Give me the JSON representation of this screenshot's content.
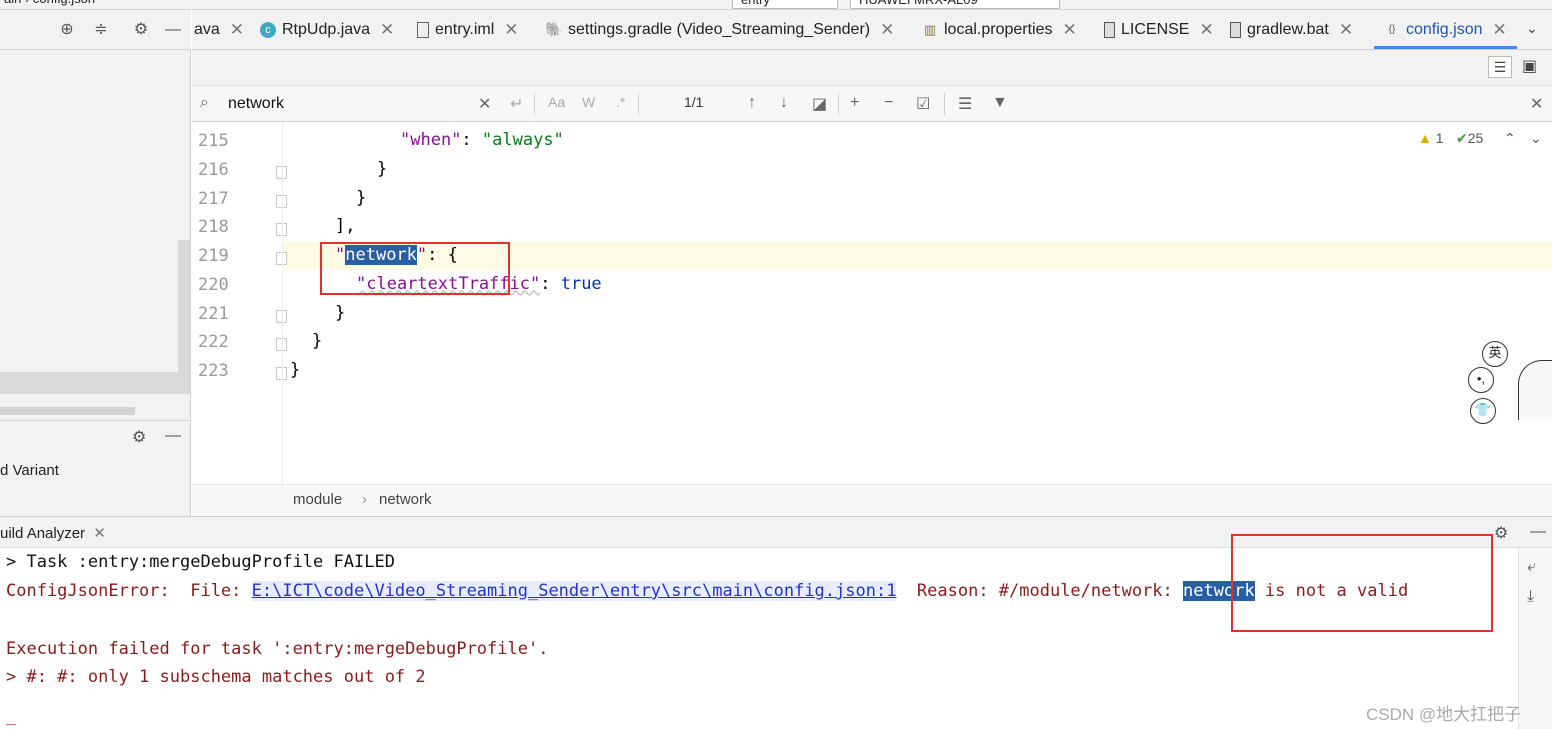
{
  "top_strip": {
    "breadcrumb_tail": "ain › config.json",
    "run_config": "entry",
    "device": "HUAWEI MRX-AL09"
  },
  "left_panel": {
    "variant_label": "d Variant"
  },
  "tabs": [
    {
      "label": "ava",
      "icon": "java-file-icon"
    },
    {
      "label": "RtpUdp.java",
      "icon": "class-icon"
    },
    {
      "label": "entry.iml",
      "icon": "iml-file-icon"
    },
    {
      "label": "settings.gradle (Video_Streaming_Sender)",
      "icon": "gradle-icon"
    },
    {
      "label": "local.properties",
      "icon": "properties-icon"
    },
    {
      "label": "LICENSE",
      "icon": "text-file-icon"
    },
    {
      "label": "gradlew.bat",
      "icon": "bat-file-icon"
    },
    {
      "label": "config.json",
      "icon": "json-file-icon",
      "active": true
    }
  ],
  "search": {
    "query": "network",
    "match_case": "Aa",
    "words": "W",
    "regex": ".*",
    "count": "1/1"
  },
  "editor": {
    "warnings": "1",
    "checks": "25",
    "lines": [
      {
        "n": "215"
      },
      {
        "n": "216"
      },
      {
        "n": "217"
      },
      {
        "n": "218"
      },
      {
        "n": "219"
      },
      {
        "n": "220"
      },
      {
        "n": "221"
      },
      {
        "n": "222"
      },
      {
        "n": "223"
      }
    ],
    "code": {
      "l215_key": "\"when\"",
      "l215_colon": ": ",
      "l215_val": "\"always\"",
      "l216": "}",
      "l217": "}",
      "l218": "],",
      "l219_q1": "\"",
      "l219_key": "network",
      "l219_q2": "\"",
      "l219_rest": ": {",
      "l220_key": "\"cleartextTraffic\"",
      "l220_colon": ": ",
      "l220_val": "true",
      "l221": "}",
      "l222": "}",
      "l223": "}"
    }
  },
  "breadcrumb": {
    "item1": "module",
    "sep": "›",
    "item2": "network"
  },
  "build": {
    "tab_label": "uild Analyzer",
    "line1": "> Task :entry:mergeDebugProfile FAILED",
    "line2_prefix": "ConfigJsonError:  File: ",
    "line2_link": "E:\\ICT\\code\\Video_Streaming_Sender\\entry\\src\\main\\config.json:1",
    "line2_reason": "  Reason: #/module/network: ",
    "line2_hl": "network",
    "line2_tail": " is not a valid",
    "line3": "Execution failed for task ':entry:mergeDebugProfile'.",
    "line4": "> #: #: only 1 subschema matches out of 2",
    "line5": "_"
  },
  "ime": {
    "lang": "英",
    "punct": "•,",
    "skin": "👕"
  },
  "watermark": "CSDN @地大扛把子"
}
